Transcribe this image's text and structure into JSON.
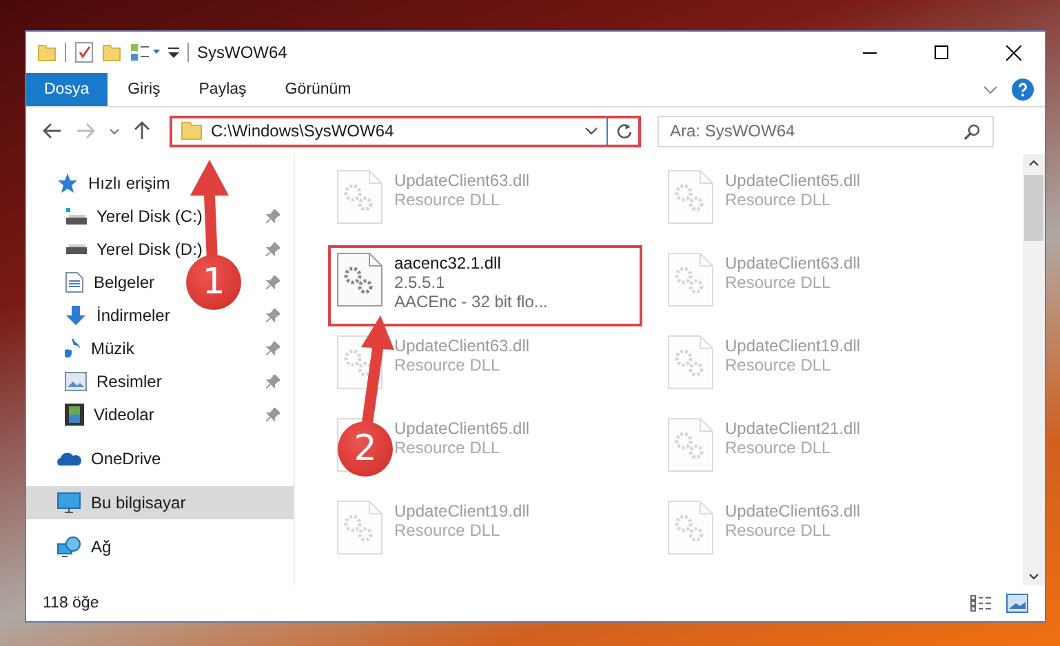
{
  "window": {
    "title": "SysWOW64"
  },
  "ribbon_tabs": [
    {
      "label": "Dosya",
      "selected": true
    },
    {
      "label": "Giriş",
      "selected": false
    },
    {
      "label": "Paylaş",
      "selected": false
    },
    {
      "label": "Görünüm",
      "selected": false
    }
  ],
  "address_bar": {
    "path": "C:\\Windows\\SysWOW64",
    "highlighted": true
  },
  "search": {
    "placeholder": "Ara: SysWOW64"
  },
  "navigation": [
    {
      "label": "Hızlı erişim",
      "kind": "star",
      "selected": false,
      "children": [
        {
          "label": "Yerel Disk (C:)",
          "kind": "systemdrive",
          "pinned": true
        },
        {
          "label": "Yerel Disk (D:)",
          "kind": "drive",
          "pinned": true
        },
        {
          "label": "Belgeler",
          "kind": "document",
          "pinned": true
        },
        {
          "label": "İndirmeler",
          "kind": "download",
          "pinned": true
        },
        {
          "label": "Müzik",
          "kind": "music",
          "pinned": true
        },
        {
          "label": "Resimler",
          "kind": "picture",
          "pinned": true
        },
        {
          "label": "Videolar",
          "kind": "video",
          "pinned": true
        }
      ]
    },
    {
      "label": "OneDrive",
      "kind": "cloud",
      "selected": false
    },
    {
      "label": "Bu bilgisayar",
      "kind": "computer",
      "selected": true
    },
    {
      "label": "Ağ",
      "kind": "network",
      "selected": false
    }
  ],
  "files": [
    {
      "name": "UpdateClient63.dll",
      "details": [
        "Resource DLL"
      ],
      "faded": true,
      "highlighted": false
    },
    {
      "name": "UpdateClient65.dll",
      "details": [
        "Resource DLL"
      ],
      "faded": true,
      "highlighted": false
    },
    {
      "name": "aacenc32.1.dll",
      "details": [
        "2.5.5.1",
        "AACEnc - 32 bit flo..."
      ],
      "faded": false,
      "highlighted": true
    },
    {
      "name": "UpdateClient63.dll",
      "details": [
        "Resource DLL"
      ],
      "faded": true,
      "highlighted": false
    },
    {
      "name": "UpdateClient63.dll",
      "details": [
        "Resource DLL"
      ],
      "faded": true,
      "highlighted": false
    },
    {
      "name": "UpdateClient19.dll",
      "details": [
        "Resource DLL"
      ],
      "faded": true,
      "highlighted": false
    },
    {
      "name": "UpdateClient65.dll",
      "details": [
        "Resource DLL"
      ],
      "faded": true,
      "highlighted": false
    },
    {
      "name": "UpdateClient21.dll",
      "details": [
        "Resource DLL"
      ],
      "faded": true,
      "highlighted": false
    },
    {
      "name": "UpdateClient19.dll",
      "details": [
        "Resource DLL"
      ],
      "faded": true,
      "highlighted": false
    },
    {
      "name": "UpdateClient63.dll",
      "details": [
        "Resource DLL"
      ],
      "faded": true,
      "highlighted": false
    }
  ],
  "status_bar": {
    "item_count": "118 öğe"
  },
  "annotations": [
    {
      "number": "1"
    },
    {
      "number": "2"
    }
  ]
}
